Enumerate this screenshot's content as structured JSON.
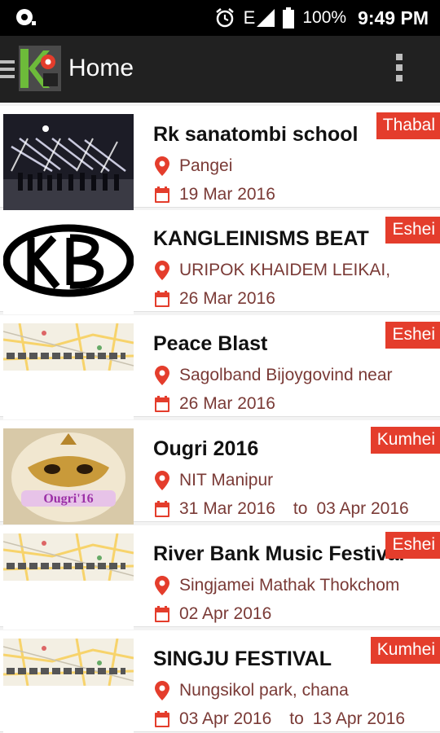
{
  "status": {
    "network": "E",
    "battery": "100%",
    "time": "9:49 PM"
  },
  "appbar": {
    "title": "Home"
  },
  "events": [
    {
      "title": "Rk sanatombi school",
      "location": "Pangei",
      "date": "19 Mar 2016",
      "to_label": "",
      "end_date": "",
      "badge": "Thabal",
      "thumb": "night-dance-photo"
    },
    {
      "title": "KANGLEINISMS BEAT",
      "location": "URIPOK KHAIDEM LEIKAI,",
      "date": "26 Mar 2016",
      "to_label": "",
      "end_date": "",
      "badge": "Eshei",
      "thumb": "kb-logo"
    },
    {
      "title": "Peace Blast",
      "location": "Sagolband Bijoygovind near",
      "date": "26 Mar 2016",
      "to_label": "",
      "end_date": "",
      "badge": "Eshei",
      "thumb": "map-placeholder"
    },
    {
      "title": "Ougri 2016",
      "location": "NIT Manipur",
      "date": "31 Mar 2016",
      "to_label": "to",
      "end_date": "03 Apr 2016",
      "badge": "Kumhei",
      "thumb": "ougri-mask-poster"
    },
    {
      "title": "River Bank Music Festival",
      "location": "Singjamei Mathak Thokchom",
      "date": "02 Apr 2016",
      "to_label": "",
      "end_date": "",
      "badge": "Eshei",
      "thumb": "map-placeholder"
    },
    {
      "title": "SINGJU FESTIVAL",
      "location": "Nungsikol park, chana",
      "date": "03 Apr 2016",
      "to_label": "to",
      "end_date": "13 Apr 2016",
      "badge": "Kumhei",
      "thumb": "map-placeholder"
    }
  ],
  "colors": {
    "badge": "#e43d2c",
    "pin": "#e43d2c",
    "detail_text": "#7a3a36",
    "appbar": "#212121"
  }
}
